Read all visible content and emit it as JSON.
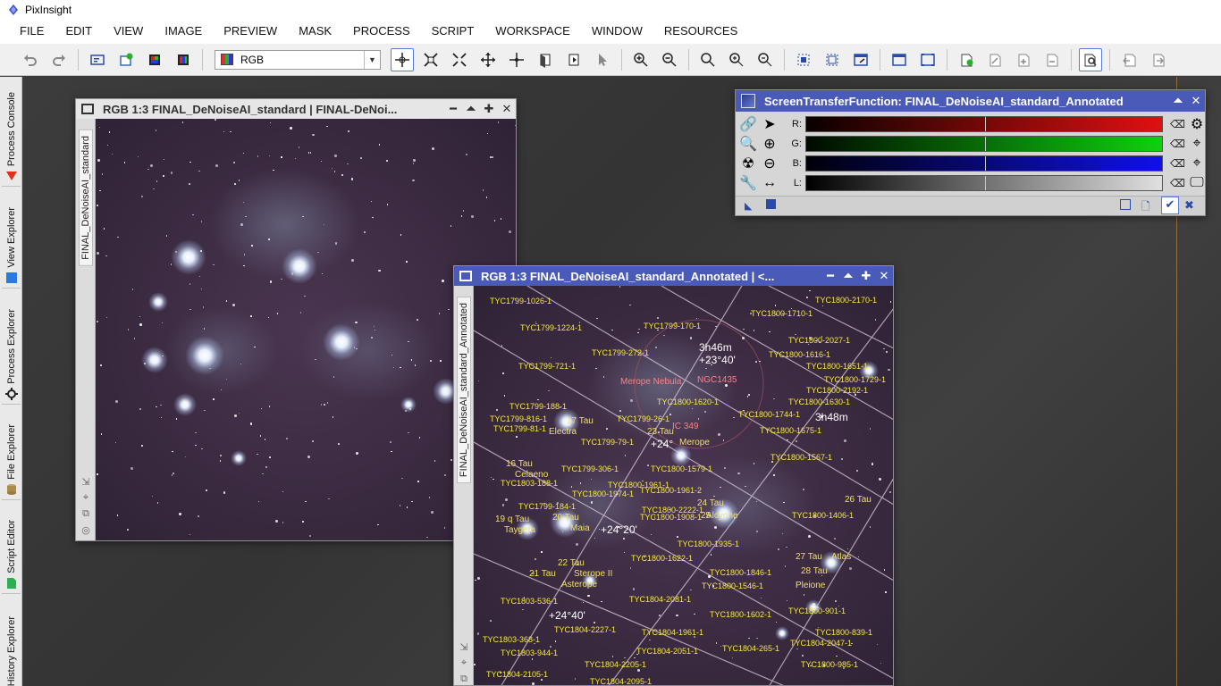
{
  "app": {
    "title": "PixInsight"
  },
  "menu": [
    "FILE",
    "EDIT",
    "VIEW",
    "IMAGE",
    "PREVIEW",
    "MASK",
    "PROCESS",
    "SCRIPT",
    "WORKSPACE",
    "WINDOW",
    "RESOURCES"
  ],
  "toolbar": {
    "channel_select": "RGB"
  },
  "dock": {
    "tabs": [
      "Process Console",
      "View Explorer",
      "Process Explorer",
      "File Explorer",
      "Script Editor",
      "History Explorer"
    ]
  },
  "window1": {
    "title": "RGB 1:3 FINAL_DeNoiseAI_standard | FINAL-DeNoi...",
    "tab_label": "FINAL_DeNoiseAI_standard"
  },
  "window2": {
    "title": "RGB 1:3 FINAL_DeNoiseAI_standard_Annotated | <...",
    "tab_label": "FINAL_DeNoiseAI_standard_Annotated",
    "coords": [
      "3h46m",
      "+23°40'",
      "3h48m",
      "+24°",
      "+24°20'",
      "+24°40'"
    ],
    "nebula": [
      "Merope Nebula",
      "NGC1435",
      "IC 349"
    ],
    "stars_named": [
      "17 Tau",
      "Electra",
      "23 Tau",
      "Merope",
      "16 Tau",
      "Celaeno",
      "24 Tau",
      "Alcyone",
      "25",
      "26 Tau",
      "19 q Tau",
      "Taygeta",
      "20 Tau",
      "Maia",
      "22 Tau",
      "Sterope II",
      "21 Tau",
      "Asterope",
      "27 Tau",
      "Atlas",
      "28 Tau",
      "Pleione"
    ],
    "tyc": [
      "TYC1799-1026-1",
      "TYC1800-2170-1",
      "TYC1800-1710-1",
      "TYC1799-1224-1",
      "TYC1799-170-1",
      "TYC1800-2027-1",
      "TYC1799-272-1",
      "TYC1800-1616-1",
      "TYC1800-1651-1",
      "TYC1799-721-1",
      "TYC1800-1729-1",
      "TYC1800-2192-1",
      "TYC1799-188-1",
      "TYC1800-1620-1",
      "TYC1800-1630-1",
      "TYC1799-816-1",
      "TYC1799-26-1",
      "TYC1800-1744-1",
      "TYC1799-81-1",
      "TYC1800-1675-1",
      "TYC1799-79-1",
      "TYC1800-1567-1",
      "TYC1799-306-1",
      "TYC1800-1579-1",
      "TYC1803-188-1",
      "TYC1800-1961-1",
      "TYC1800-1974-1",
      "TYC1800-1961-2",
      "TYC1799-184-1",
      "TYC1800-2222-1",
      "TYC1800-1908-1",
      "TYC1800-1406-1",
      "TYC1800-1935-1",
      "TYC1800-1622-1",
      "TYC1800-1846-1",
      "TYC1800-1546-1",
      "TYC1803-536-1",
      "TYC1804-2081-1",
      "TYC1800-901-1",
      "TYC1800-1602-1",
      "TYC1804-2227-1",
      "TYC1804-1961-1",
      "TYC1800-839-1",
      "TYC1803-368-1",
      "TYC1804-2047-1",
      "TYC1803-944-1",
      "TYC1804-2051-1",
      "TYC1804-265-1",
      "TYC1804-2205-1",
      "TYC1800-985-1",
      "TYC1804-2105-1",
      "TYC1804-2095-1"
    ]
  },
  "stf": {
    "title": "ScreenTransferFunction: FINAL_DeNoiseAI_standard_Annotated",
    "channels": [
      {
        "label": "R:",
        "color": "#e01010"
      },
      {
        "label": "G:",
        "color": "#10d010"
      },
      {
        "label": "B:",
        "color": "#1010e8"
      },
      {
        "label": "L:",
        "color": "#e0e0e0"
      }
    ]
  },
  "colors": {
    "active_title": "#4a5ab8",
    "annotation": "#f5e84a"
  }
}
